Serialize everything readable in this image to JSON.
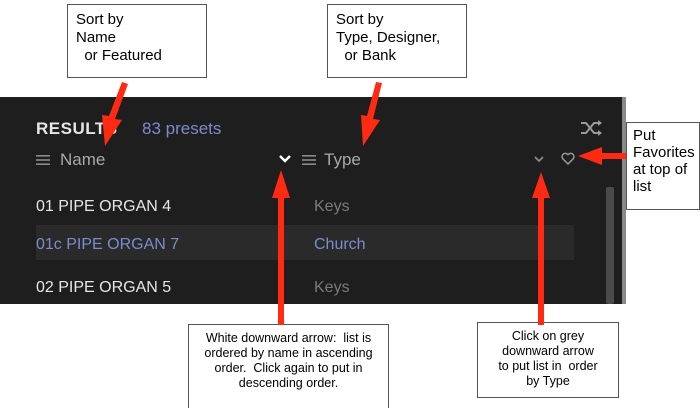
{
  "callouts": {
    "sort_name": [
      "Sort by",
      "Name",
      "  or Featured"
    ],
    "sort_type": [
      "Sort by",
      "Type, Designer,",
      "  or Bank"
    ],
    "favorites": [
      "Put",
      "Favorites",
      "at top of",
      "list"
    ],
    "white_arrow": [
      "White downward arrow:  list is",
      "ordered by name in ascending",
      "order.  Click again to put in",
      "descending order."
    ],
    "grey_arrow": [
      "Click on grey",
      "downward arrow",
      "to put list in  order",
      "by Type"
    ]
  },
  "panel": {
    "results_label": "RESULTS",
    "presets_count": "83 presets",
    "columns": {
      "name": "Name",
      "type": "Type"
    },
    "rows": [
      {
        "name": "01  PIPE ORGAN 4",
        "type": "Keys",
        "selected": false
      },
      {
        "name": "01c  PIPE ORGAN 7",
        "type": "Church",
        "selected": true
      },
      {
        "name": "02  PIPE ORGAN 5",
        "type": "Keys",
        "selected": false
      }
    ]
  },
  "colors": {
    "panel_bg": "#1e1e1e",
    "selected_row_bg": "#2a2a2a",
    "accent_blue": "#7a8ccf",
    "annotation_red": "#ff2a12",
    "header_grey": "#a9a9a9"
  },
  "icons": [
    "hamburger-icon",
    "chevron-down-icon",
    "shuffle-icon",
    "heart-icon"
  ]
}
